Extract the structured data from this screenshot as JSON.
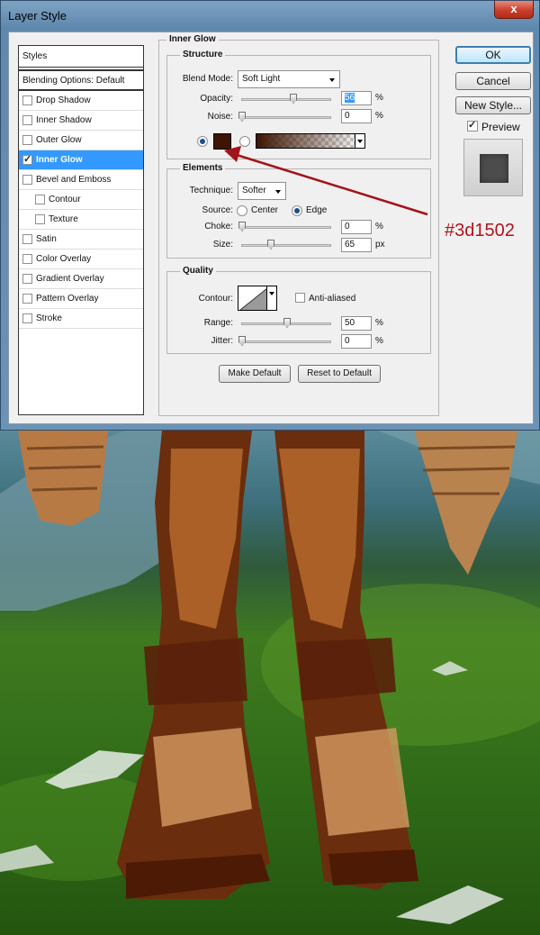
{
  "window": {
    "title": "Layer Style",
    "close_glyph": "x"
  },
  "styles_list": {
    "header": "Styles",
    "blending_options": "Blending Options: Default",
    "items": [
      {
        "label": "Drop Shadow",
        "checked": false,
        "active": false,
        "sub": false
      },
      {
        "label": "Inner Shadow",
        "checked": false,
        "active": false,
        "sub": false
      },
      {
        "label": "Outer Glow",
        "checked": false,
        "active": false,
        "sub": false
      },
      {
        "label": "Inner Glow",
        "checked": true,
        "active": true,
        "sub": false
      },
      {
        "label": "Bevel and Emboss",
        "checked": false,
        "active": false,
        "sub": false
      },
      {
        "label": "Contour",
        "checked": false,
        "active": false,
        "sub": true
      },
      {
        "label": "Texture",
        "checked": false,
        "active": false,
        "sub": true
      },
      {
        "label": "Satin",
        "checked": false,
        "active": false,
        "sub": false
      },
      {
        "label": "Color Overlay",
        "checked": false,
        "active": false,
        "sub": false
      },
      {
        "label": "Gradient Overlay",
        "checked": false,
        "active": false,
        "sub": false
      },
      {
        "label": "Pattern Overlay",
        "checked": false,
        "active": false,
        "sub": false
      },
      {
        "label": "Stroke",
        "checked": false,
        "active": false,
        "sub": false
      }
    ]
  },
  "inner_glow": {
    "title": "Inner Glow",
    "structure": {
      "title": "Structure",
      "blend_mode_label": "Blend Mode:",
      "blend_mode_value": "Soft Light",
      "opacity_label": "Opacity:",
      "opacity_value": "56",
      "opacity_unit": "%",
      "noise_label": "Noise:",
      "noise_value": "0",
      "noise_unit": "%",
      "glow_color": "#3d1502"
    },
    "elements": {
      "title": "Elements",
      "technique_label": "Technique:",
      "technique_value": "Softer",
      "source_label": "Source:",
      "source_center": "Center",
      "source_edge": "Edge",
      "choke_label": "Choke:",
      "choke_value": "0",
      "choke_unit": "%",
      "size_label": "Size:",
      "size_value": "65",
      "size_unit": "px"
    },
    "quality": {
      "title": "Quality",
      "contour_label": "Contour:",
      "anti_aliased_label": "Anti-aliased",
      "range_label": "Range:",
      "range_value": "50",
      "range_unit": "%",
      "jitter_label": "Jitter:",
      "jitter_value": "0",
      "jitter_unit": "%"
    },
    "make_default": "Make Default",
    "reset_default": "Reset to Default"
  },
  "actions": {
    "ok": "OK",
    "cancel": "Cancel",
    "new_style": "New Style...",
    "preview_label": "Preview",
    "preview_checked": true
  },
  "annotation": {
    "text": "#3d1502",
    "color": "#b0141c"
  },
  "colors": {
    "selection": "#3399ff",
    "glow": "#3d1502",
    "arrow": "#a31319"
  }
}
